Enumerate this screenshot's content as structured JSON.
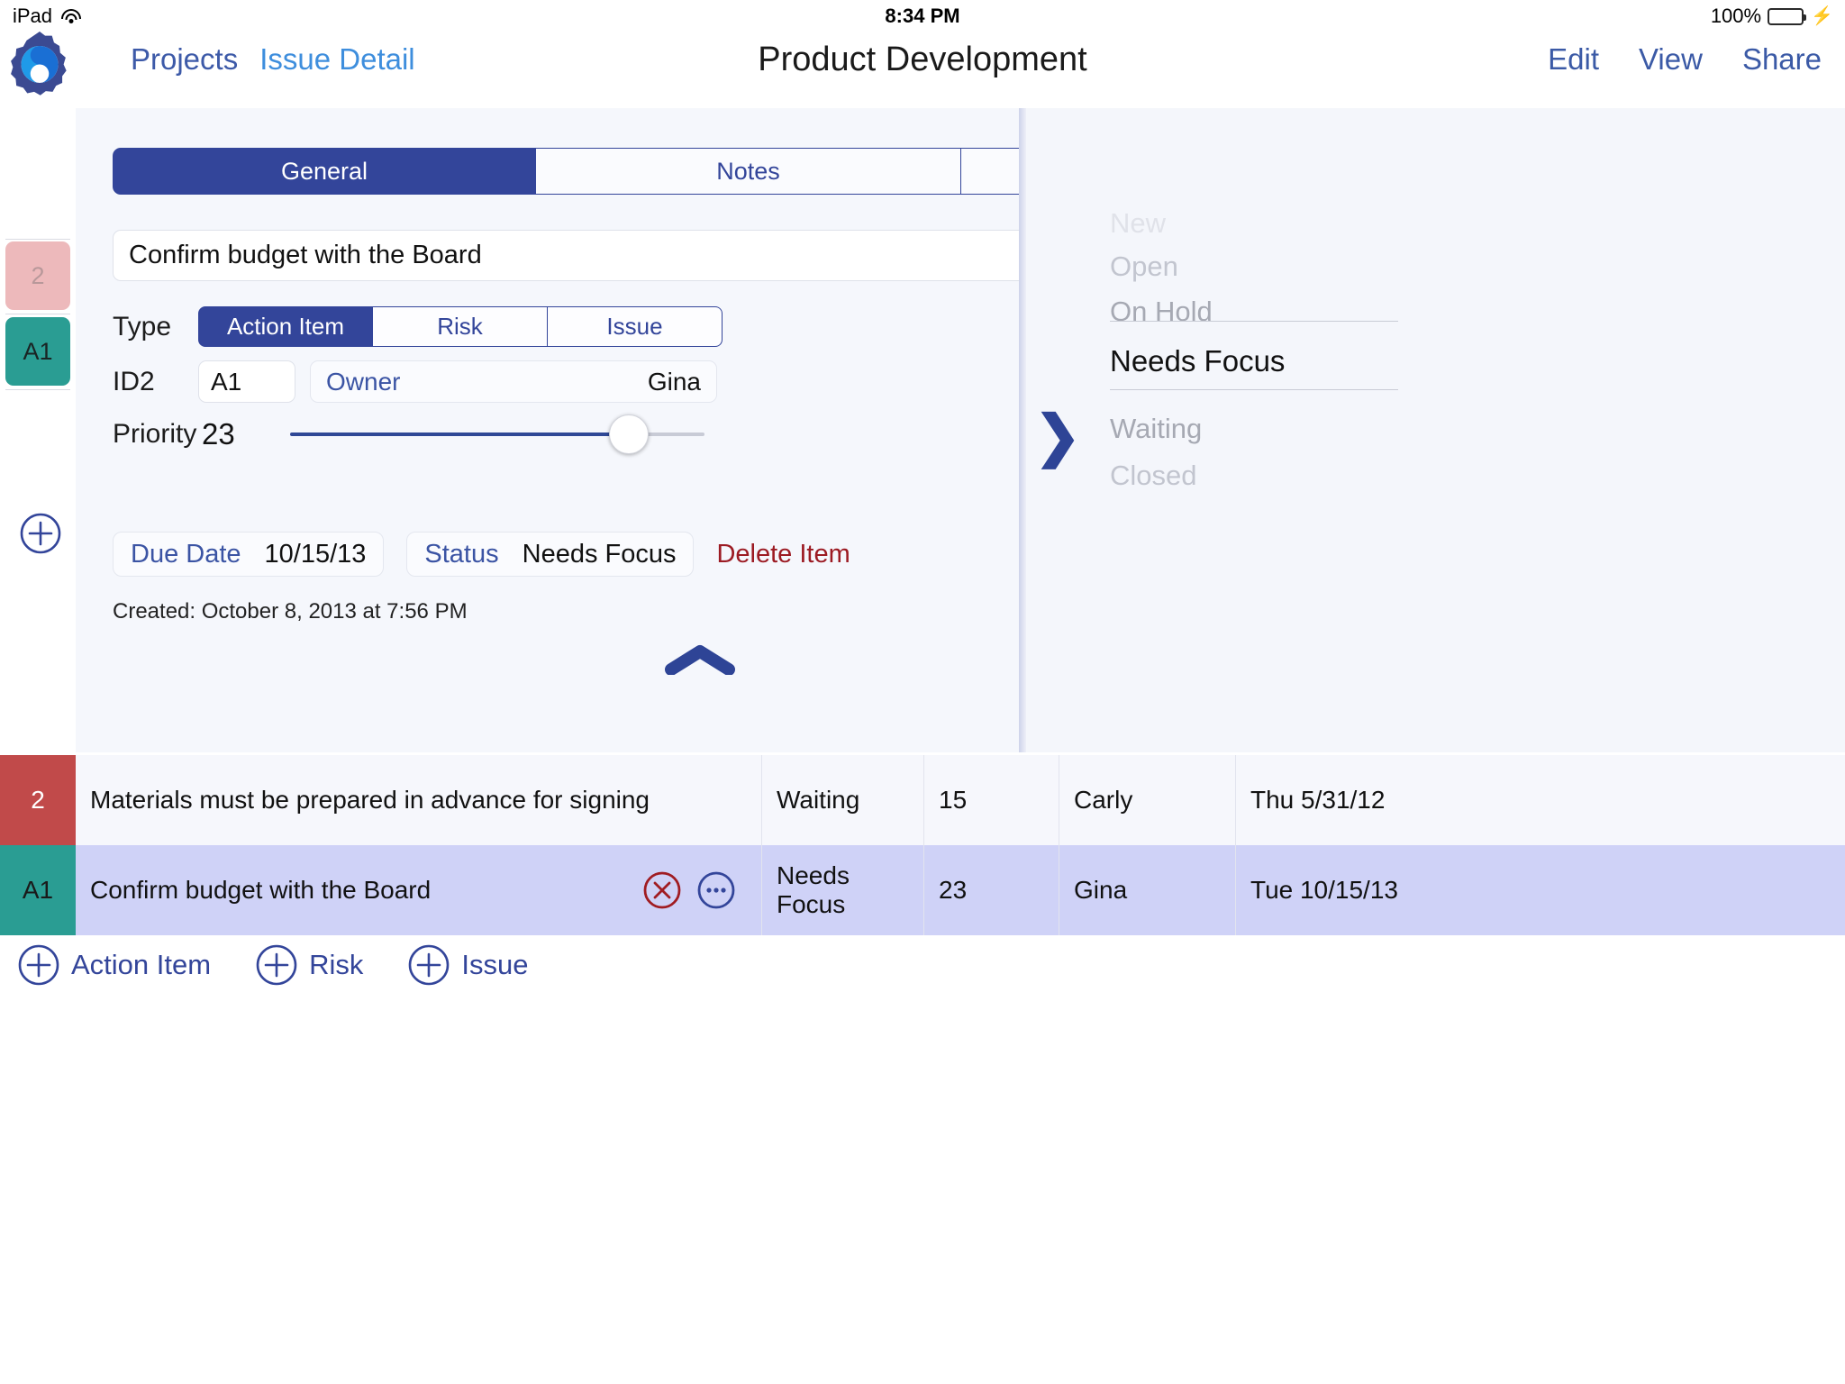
{
  "status_bar": {
    "device": "iPad",
    "wifi_icon": "wifi-icon",
    "time": "8:34 PM",
    "battery_percent": "100%",
    "battery_icon": "battery-full-icon",
    "charging_icon": "lightning-bolt-icon"
  },
  "nav": {
    "logo_icon": "app-logo-gear-icon",
    "back_label": "Projects",
    "current_label": "Issue Detail",
    "title": "Product Development",
    "edit_label": "Edit",
    "view_label": "View",
    "share_label": "Share"
  },
  "detail": {
    "tabs": [
      {
        "label": "General",
        "active": true
      },
      {
        "label": "Notes",
        "active": false
      },
      {
        "label": "",
        "active": false
      }
    ],
    "title_value": "Confirm budget with the Board",
    "type": {
      "label": "Type",
      "options": [
        "Action Item",
        "Risk",
        "Issue"
      ],
      "selected": "Action Item"
    },
    "id2": {
      "label": "ID2",
      "value": "A1"
    },
    "owner": {
      "label": "Owner",
      "value": "Gina"
    },
    "priority": {
      "label": "Priority",
      "value": "23",
      "percent": 85,
      "min": 0,
      "max": 100
    },
    "due_date": {
      "label": "Due Date",
      "value": "10/15/13"
    },
    "status": {
      "label": "Status",
      "value": "Needs Focus"
    },
    "delete_label": "Delete Item",
    "created": "Created: October 8, 2013 at 7:56 PM",
    "collapse_icon": "chevron-up-handle-icon"
  },
  "rail": {
    "chips": [
      {
        "label": "2",
        "color": "#edb9bb",
        "text_color": "#b8989a"
      },
      {
        "label": "A1",
        "color": "#2a9d93",
        "text_color": "#1a2424"
      }
    ],
    "add_icon": "plus-circle-icon"
  },
  "status_picker": {
    "chevron_icon": "chevron-right-icon",
    "options": [
      "New",
      "Open",
      "On Hold",
      "Needs Focus",
      "Waiting",
      "Closed"
    ],
    "selected": "Needs Focus"
  },
  "table": {
    "rows": [
      {
        "badge": "2",
        "badge_color": "#c14a4a",
        "badge_text_color": "#ffffff",
        "title": "Materials must be prepared in advance for signing",
        "status": "Waiting",
        "priority": "15",
        "owner": "Carly",
        "date": "Thu 5/31/12",
        "selected": false,
        "row_bg": "#f6f7fc"
      },
      {
        "badge": "A1",
        "badge_color": "#2a9d93",
        "badge_text_color": "#1a1a1a",
        "title": "Confirm budget with the Board",
        "status": "Needs Focus",
        "priority": "23",
        "owner": "Gina",
        "date": "Tue 10/15/13",
        "selected": true,
        "row_bg": "#cfd2f7",
        "delete_icon": "x-circle-icon",
        "more_icon": "ellipsis-circle-icon"
      }
    ]
  },
  "add_bar": {
    "buttons": [
      {
        "label": "Action Item",
        "icon": "plus-circle-icon"
      },
      {
        "label": "Risk",
        "icon": "plus-circle-icon"
      },
      {
        "label": "Issue",
        "icon": "plus-circle-icon"
      }
    ]
  },
  "colors": {
    "brand_blue": "#33459a",
    "link_blue": "#3b54a4",
    "accent_blue": "#3e8edd",
    "danger_red": "#9c1b23",
    "teal": "#2a9d93",
    "row_selected": "#cfd2f7"
  }
}
